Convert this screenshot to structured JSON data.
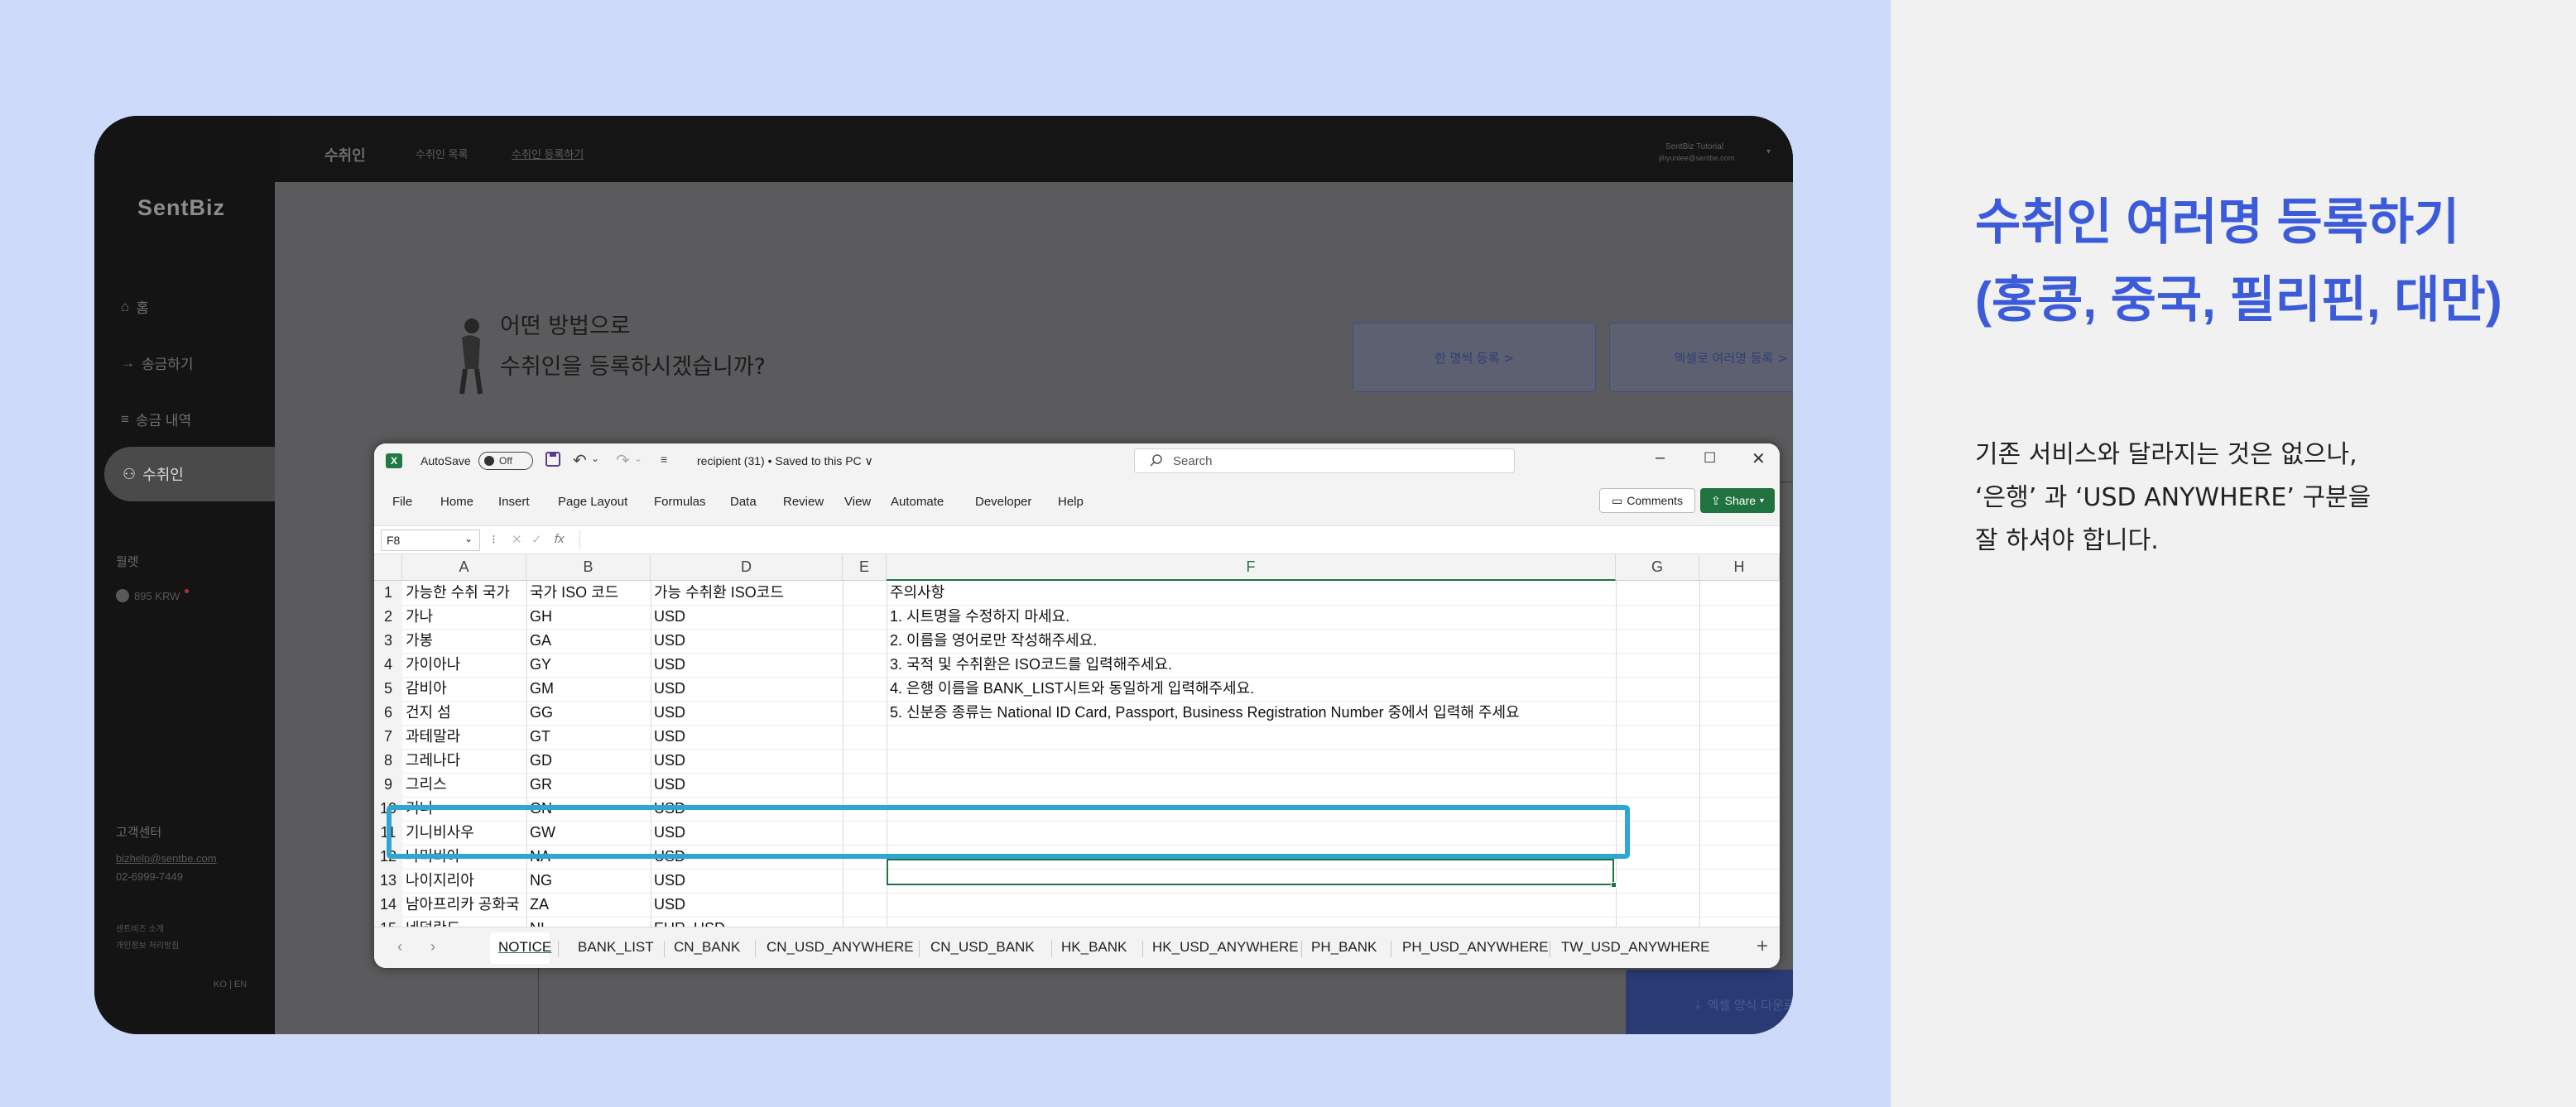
{
  "right_panel": {
    "title": "수취인 여러명 등록하기\n(홍콩, 중국, 필리핀, 대만)",
    "description": "기존 서비스와 달라지는 것은 없으나,\n‘은행’ 과 ‘USD ANYWHERE’ 구분을\n잘 하셔야 합니다.",
    "title_color": "#3b5bdb"
  },
  "app": {
    "logo": "SentBiz",
    "nav": {
      "home": "홈",
      "send": "송금하기",
      "history": "송금 내역",
      "recipient": "수취인"
    },
    "wallet_label": "월렛",
    "wallet_amount": "895 KRW",
    "support_title": "고객센터",
    "support_email": "bizhelp@sentbe.com",
    "support_phone": "02-6999-7449",
    "footer_1": "센트비즈 소개",
    "footer_2": "개인정보 처리방침",
    "lang": "KO | EN",
    "top_title": "수취인",
    "top_link_1": "수취인 목록",
    "top_link_2": "수취인 등록하기",
    "user_name": "SentBiz Tutorial",
    "user_email": "jihyunlee@sentbe.com",
    "hero_text": "어떤 방법으로\n수취인을 등록하시겠습니까?",
    "btn_single": "한 명씩 등록 >",
    "btn_excel": "엑셀로 여러명 등록 >",
    "btn_download": "엑셀 양식 다운로드"
  },
  "excel": {
    "autosave_label": "AutoSave",
    "autosave_state": "Off",
    "file_title": "recipient (31) • Saved to this PC ∨",
    "search_placeholder": "Search",
    "menus": [
      "File",
      "Home",
      "Insert",
      "Page Layout",
      "Formulas",
      "Data",
      "Review",
      "View",
      "Automate",
      "Developer",
      "Help"
    ],
    "comments_label": "Comments",
    "share_label": "Share",
    "name_box": "F8",
    "columns": [
      "A",
      "B",
      "D",
      "E",
      "F",
      "G",
      "H"
    ],
    "rows": [
      {
        "n": "1",
        "a": "가능한 수취 국가",
        "b": "국가 ISO 코드",
        "d": "가능 수취환 ISO코드",
        "f": "주의사항"
      },
      {
        "n": "2",
        "a": "가나",
        "b": "GH",
        "d": "USD",
        "f": "1. 시트명을 수정하지 마세요."
      },
      {
        "n": "3",
        "a": "가봉",
        "b": "GA",
        "d": "USD",
        "f": "2. 이름을 영어로만 작성해주세요."
      },
      {
        "n": "4",
        "a": "가이아나",
        "b": "GY",
        "d": "USD",
        "f": "3. 국적 및 수취환은 ISO코드를 입력해주세요."
      },
      {
        "n": "5",
        "a": "감비아",
        "b": "GM",
        "d": "USD",
        "f": "4. 은행 이름을 BANK_LIST시트와 동일하게 입력해주세요."
      },
      {
        "n": "6",
        "a": "건지 섬",
        "b": "GG",
        "d": "USD",
        "f": "5. 신분증 종류는 National ID Card, Passport, Business Registration Number 중에서 입력해 주세요"
      },
      {
        "n": "7",
        "a": "과테말라",
        "b": "GT",
        "d": "USD",
        "f": ""
      },
      {
        "n": "8",
        "a": "그레나다",
        "b": "GD",
        "d": "USD",
        "f": ""
      },
      {
        "n": "9",
        "a": "그리스",
        "b": "GR",
        "d": "USD",
        "f": ""
      },
      {
        "n": "10",
        "a": "기니",
        "b": "GN",
        "d": "USD",
        "f": ""
      },
      {
        "n": "11",
        "a": "기니비사우",
        "b": "GW",
        "d": "USD",
        "f": ""
      },
      {
        "n": "12",
        "a": "나미비아",
        "b": "NA",
        "d": "USD",
        "f": ""
      },
      {
        "n": "13",
        "a": "나이지리아",
        "b": "NG",
        "d": "USD",
        "f": ""
      },
      {
        "n": "14",
        "a": "남아프리카 공화국",
        "b": "ZA",
        "d": "USD",
        "f": ""
      },
      {
        "n": "15",
        "a": "네덜란드",
        "b": "NL",
        "d": "EUR, USD",
        "f": ""
      }
    ],
    "tabs": [
      "NOTICE",
      "BANK_LIST",
      "CN_BANK",
      "CN_USD_ANYWHERE",
      "CN_USD_BANK",
      "HK_BANK",
      "HK_USD_ANYWHERE",
      "PH_BANK",
      "PH_USD_ANYWHERE",
      "TW_USD_ANYWHERE"
    ],
    "active_tab": "NOTICE",
    "accent": "#217346",
    "highlight_color": "#2ea6d4"
  }
}
